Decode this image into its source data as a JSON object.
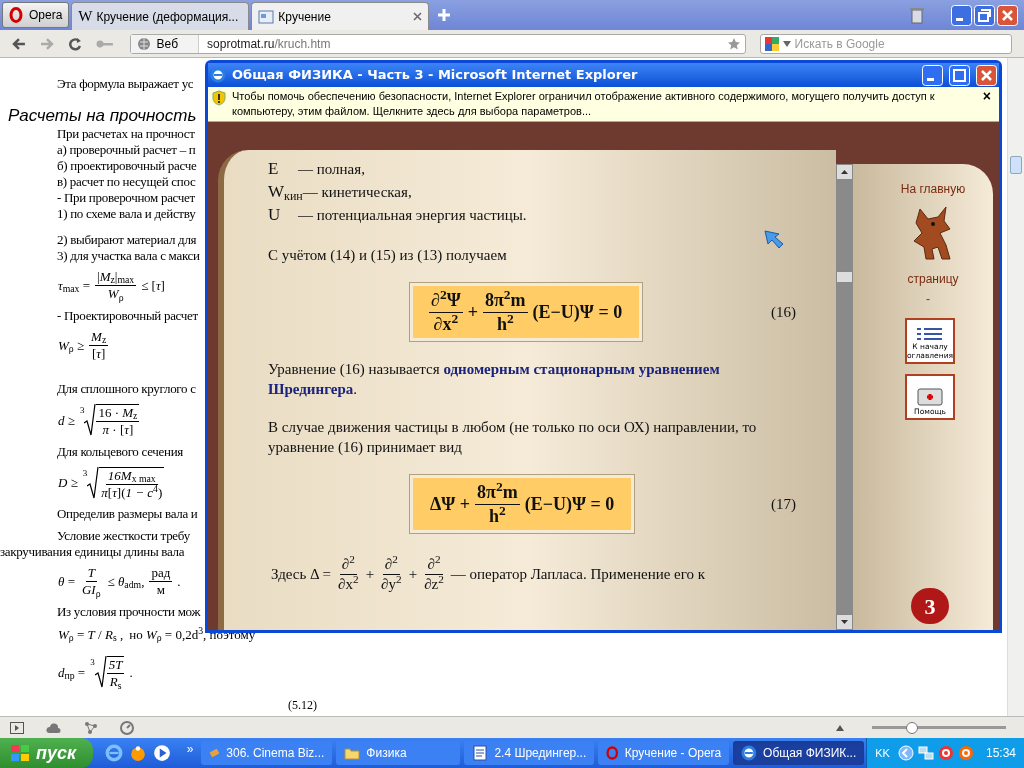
{
  "browser": {
    "menu_button": "Opera",
    "tabs": [
      {
        "title": "Кручение (деформация...",
        "selected": false,
        "kind": "letter",
        "icon_text": "W"
      },
      {
        "title": "Кручение",
        "selected": true,
        "kind": "page"
      }
    ],
    "address": {
      "label": "Веб",
      "domain": "soprotmat.ru",
      "path": "/kruch.htm"
    },
    "search": {
      "placeholder": "Искать в Google"
    }
  },
  "page": {
    "blocks": [
      {
        "kind": "text",
        "text": "Эта формула выражает ус"
      },
      {
        "kind": "heading",
        "text": "Расчеты на прочность"
      },
      {
        "kind": "text",
        "text": "При расчетах на прочност"
      },
      {
        "kind": "text",
        "text": "а) проверочный расчет – п"
      },
      {
        "kind": "text",
        "text": "б) проектировочный расче"
      },
      {
        "kind": "text",
        "text": "в) расчет по несущей спос"
      },
      {
        "kind": "text",
        "text": "- При проверочном расчет"
      },
      {
        "kind": "text",
        "text": "1) по схеме вала и действу"
      },
      {
        "kind": "text",
        "text": "2) выбирают материал для"
      },
      {
        "kind": "text",
        "text": "3) для участка вала с макси"
      },
      {
        "kind": "formula",
        "terms": [
          {
            "kind": "text",
            "text": "*τ*$_{max}$ ="
          },
          {
            "kind": "frac",
            "num": "|*M*$_{z}$|$_{max}$",
            "den": "*W*$_{ρ}$"
          },
          {
            "kind": "text",
            "text": "≤ [*τ*]"
          }
        ]
      },
      {
        "kind": "text",
        "text": "- Проектировочный расчет"
      },
      {
        "kind": "formula",
        "terms": [
          {
            "kind": "text",
            "text": "*W*$_{ρ}$ ≥"
          },
          {
            "kind": "frac",
            "num": "*M*$_{z}$",
            "den": "[*τ*]"
          }
        ]
      },
      {
        "kind": "text",
        "text": "Для сплошного круглого с"
      },
      {
        "kind": "formula",
        "terms": [
          {
            "kind": "text",
            "text": "*d* ≥"
          },
          {
            "kind": "root",
            "index": "3",
            "num": "16 · *M*$_{z}$",
            "den": "*π* · [*τ*]"
          }
        ]
      },
      {
        "kind": "text",
        "text": "Для кольцевого сечения"
      },
      {
        "kind": "formula",
        "terms": [
          {
            "kind": "text",
            "text": "*D* ≥"
          },
          {
            "kind": "root",
            "index": "3",
            "num": "*16M*$_{x max}$",
            "den": "*π*[*τ*](*1 − c*$^{4}$)"
          }
        ]
      },
      {
        "kind": "text",
        "text": "Определив размеры вала и"
      },
      {
        "kind": "text",
        "text": "Условие  жесткости  требу"
      },
      {
        "kind": "flush_text",
        "text": "закручивания единицы длины вала"
      },
      {
        "kind": "formula",
        "terms": [
          {
            "kind": "text",
            "text": "*θ* ="
          },
          {
            "kind": "frac",
            "num": "*T*",
            "den": "*GI*$_{ρ}$"
          },
          {
            "kind": "text",
            "text": "≤ *θ*$_{adm}$,"
          },
          {
            "kind": "frac",
            "num": "рад",
            "den": "м"
          },
          {
            "kind": "text",
            "text": "."
          }
        ]
      },
      {
        "kind": "text",
        "text": "Из условия прочности мож"
      },
      {
        "kind": "formula",
        "terms": [
          {
            "kind": "text",
            "text": "*W*$_{ρ}$ = *T* / *R*$_{s}$ ,"
          },
          {
            "kind": "text",
            "text": "но *W*$_{ρ}$ = 0,2d$^{3}$, поэтому"
          }
        ]
      },
      {
        "kind": "formula",
        "terms": [
          {
            "kind": "text",
            "text": "*d*$_{пр}$ ="
          },
          {
            "kind": "root",
            "index": "3",
            "num": "*5T*",
            "den": "*R*$_{s}$"
          },
          {
            "kind": "text",
            "text": "."
          }
        ]
      },
      {
        "kind": "number",
        "text": "(5.12)"
      }
    ]
  },
  "popup": {
    "title": "Общая ФИЗИКА - Часть 3 - Microsoft Internet Explorer",
    "info_bar": "Чтобы помочь обеспечению безопасности, Internet Explorer ограничил отображение активного содержимого, могущего получить доступ к компьютеру, этим файлом. Щелкните здесь для выбора параметров...",
    "info_close": "×",
    "definitions": [
      {
        "symbol": "E",
        "text": "— полная,"
      },
      {
        "symbol": "W$_{кин}$",
        "text": "— кинетическая,"
      },
      {
        "symbol": "U",
        "text": "— потенциальная энергия частицы."
      }
    ],
    "content": [
      {
        "kind": "paragraph",
        "text": "С учётом (14) и (15) из (13) получаем"
      },
      {
        "kind": "equation",
        "number": "(16)",
        "terms": [
          {
            "kind": "frac",
            "num": "∂$^{2}$Ψ",
            "den": "∂x$^{2}$"
          },
          {
            "kind": "text",
            "text": "+"
          },
          {
            "kind": "frac",
            "num": "8π$^{2}$m",
            "den": "h$^{2}$"
          },
          {
            "kind": "text",
            "text": "(E−U)Ψ = 0"
          }
        ]
      },
      {
        "kind": "paragraph",
        "text": "Уравнение (16) называется **одномерным стационарным уравнением Шредингера**."
      },
      {
        "kind": "paragraph",
        "text": "В случае движения частицы в любом (не только по оси ОХ) направлении, то уравнение (16) принимает вид"
      },
      {
        "kind": "equation",
        "number": "(17)",
        "terms": [
          {
            "kind": "text",
            "text": "ΔΨ +"
          },
          {
            "kind": "frac",
            "num": "8π$^{2}$m",
            "den": "h$^{2}$"
          },
          {
            "kind": "text",
            "text": "(E−U)Ψ = 0"
          }
        ]
      },
      {
        "kind": "formula_line",
        "terms": [
          {
            "kind": "text",
            "text": "Здесь  Δ ="
          },
          {
            "kind": "frac",
            "num": "∂$^{2}$",
            "den": "∂x$^{2}$"
          },
          {
            "kind": "text",
            "text": "+"
          },
          {
            "kind": "frac",
            "num": "∂$^{2}$",
            "den": "∂y$^{2}$"
          },
          {
            "kind": "text",
            "text": "+"
          },
          {
            "kind": "frac",
            "num": "∂$^{2}$",
            "den": "∂z$^{2}$"
          },
          {
            "kind": "text",
            "text": "— оператор Лапласа. Применение его к"
          }
        ]
      }
    ],
    "nav": {
      "home_top": "На главную",
      "home_bottom": "страницу",
      "dash": "-",
      "buttons": [
        {
          "kind": "contents",
          "text": "К началу оглавления"
        },
        {
          "kind": "help",
          "text": "Помощь"
        }
      ],
      "apple_text": "3"
    }
  },
  "status_bar": {
    "zoom": {
      "level": 0.3
    }
  },
  "taskbar": {
    "start": "пуск",
    "more": "»",
    "tasks": [
      {
        "kind": "media",
        "title": "306. Cinema Biz...",
        "selected": false
      },
      {
        "kind": "folder",
        "title": "Физика",
        "selected": false
      },
      {
        "kind": "word",
        "title": "2.4 Шредингер...",
        "selected": false
      },
      {
        "kind": "opera",
        "title": "Кручение - Opera",
        "selected": false
      },
      {
        "kind": "ie",
        "title": "Общая ФИЗИК...",
        "selected": true
      }
    ],
    "language": "KK",
    "clock": "15:34"
  }
}
